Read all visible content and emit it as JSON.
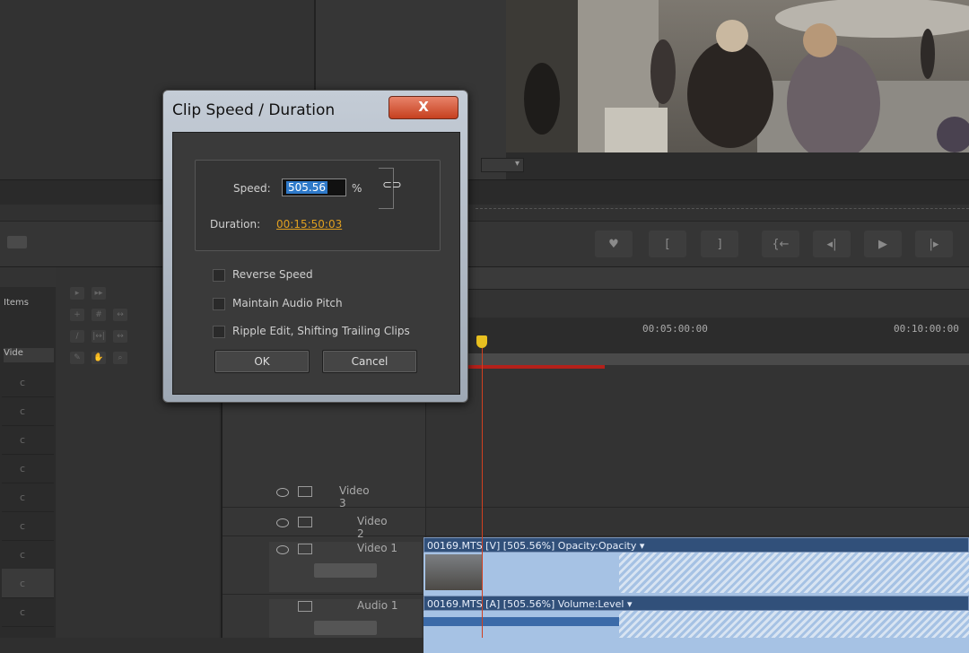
{
  "dialog": {
    "title": "Clip Speed / Duration",
    "close_glyph": "X",
    "speed_label": "Speed:",
    "speed_value": "505.56",
    "percent": "%",
    "duration_label": "Duration:",
    "duration_value": "00:15:50:03",
    "options": [
      {
        "label": "Reverse Speed",
        "checked": false
      },
      {
        "label": "Maintain Audio Pitch",
        "checked": false
      },
      {
        "label": "Ripple Edit, Shifting Trailing Clips",
        "checked": false
      }
    ],
    "ok_label": "OK",
    "cancel_label": "Cancel"
  },
  "project": {
    "items_label": "Items",
    "video_col_label": "Vide",
    "row_glyph": "c"
  },
  "timeline": {
    "timecodes": [
      "00:05:00:00",
      "00:10:00:00"
    ],
    "tracks": [
      {
        "label": "Video 3"
      },
      {
        "label": "Video 2"
      },
      {
        "label": "Video 1"
      },
      {
        "label": "Audio 1"
      }
    ],
    "video_clip_title": "00169.MTS [V] [505.56%]  Opacity:Opacity ▾",
    "audio_clip_title": "00169.MTS [A] [505.56%]  Volume:Level ▾"
  },
  "transport": {
    "buttons": [
      "♥",
      "[",
      "]",
      "{←",
      "◂|",
      "▶",
      "|▸"
    ]
  },
  "colors": {
    "accent_selection": "#2e79c9",
    "duration_text": "#e0a020",
    "playhead": "#d04020",
    "clip_header": "#31507a",
    "clip_body": "#a6c2e4",
    "close_button": "#c6401f"
  }
}
